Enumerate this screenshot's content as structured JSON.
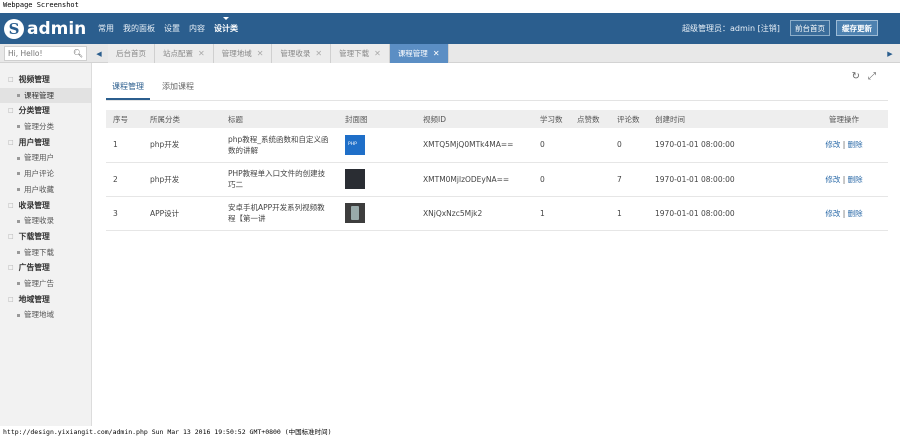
{
  "caption": "Webpage Screenshot",
  "header": {
    "logo_letter": "S",
    "logo_text": "admin",
    "nav": [
      "常用",
      "我的面板",
      "设置",
      "内容",
      "设计类"
    ],
    "active_nav": "设计类",
    "user_text": "超级管理员：admin [注销]",
    "front_button": "前台首页",
    "cache_button": "缓存更新",
    "brand_color": "#2b5e8e"
  },
  "tabbar": {
    "search_placeholder": "Hi, Hello!",
    "search_icon": "search-icon",
    "left_arrow": "◀",
    "right_arrow": "▶",
    "tabs": [
      {
        "label": "后台首页",
        "closable": false,
        "active": false
      },
      {
        "label": "站点配置",
        "closable": true,
        "active": false
      },
      {
        "label": "管理地域",
        "closable": true,
        "active": false
      },
      {
        "label": "管理收录",
        "closable": true,
        "active": false
      },
      {
        "label": "管理下载",
        "closable": true,
        "active": false
      },
      {
        "label": "课程管理",
        "closable": true,
        "active": true
      }
    ],
    "active_tab_color": "#5b8ec4"
  },
  "sidebar": {
    "groups": [
      {
        "label": "视频管理",
        "items": [
          {
            "label": "课程管理",
            "active": true
          }
        ]
      },
      {
        "label": "分类管理",
        "items": [
          {
            "label": "管理分类",
            "active": false
          }
        ]
      },
      {
        "label": "用户管理",
        "items": [
          {
            "label": "管理用户",
            "active": false
          },
          {
            "label": "用户评论",
            "active": false
          },
          {
            "label": "用户收藏",
            "active": false
          }
        ]
      },
      {
        "label": "收录管理",
        "items": [
          {
            "label": "管理收录",
            "active": false
          }
        ]
      },
      {
        "label": "下载管理",
        "items": [
          {
            "label": "管理下载",
            "active": false
          }
        ]
      },
      {
        "label": "广告管理",
        "items": [
          {
            "label": "管理广告",
            "active": false
          }
        ]
      },
      {
        "label": "地域管理",
        "items": [
          {
            "label": "管理地域",
            "active": false
          }
        ]
      }
    ]
  },
  "main": {
    "tabs": [
      "课程管理",
      "添加课程"
    ],
    "active_tab": "课程管理",
    "refresh_icon": "refresh-icon",
    "fullscreen_icon": "fullscreen-icon",
    "columns": [
      "序号",
      "所属分类",
      "标题",
      "封面图",
      "视频ID",
      "学习数",
      "点赞数",
      "评论数",
      "创建时间",
      "管理操作"
    ],
    "rows": [
      {
        "id": "1",
        "category": "php开发",
        "title": "php教程_系统函数和自定义函数的讲解",
        "cover": "thumb1",
        "video_id": "XMTQ5MjQ0MTk4MA==",
        "learn": "0",
        "likes": "",
        "comments": "0",
        "created": "1970-01-01 08:00:00",
        "edit": "修改",
        "delete": "删除"
      },
      {
        "id": "2",
        "category": "php开发",
        "title": "PHP教程单入口文件的创建技巧二",
        "cover": "thumb2",
        "video_id": "XMTM0MjlzODEyNA==",
        "learn": "0",
        "likes": "",
        "comments": "7",
        "created": "1970-01-01 08:00:00",
        "edit": "修改",
        "delete": "删除"
      },
      {
        "id": "3",
        "category": "APP设计",
        "title": "安卓手机APP开发系列视频教程【第一讲",
        "cover": "thumb3",
        "video_id": "XNjQxNzc5Mjk2",
        "learn": "1",
        "likes": "",
        "comments": "1",
        "created": "1970-01-01 08:00:00",
        "edit": "修改",
        "delete": "删除"
      }
    ]
  },
  "status_bar": "http://design.yixiangit.com/admin.php Sun Mar 13 2016 19:50:52 GMT+0800 (中国标准时间)"
}
